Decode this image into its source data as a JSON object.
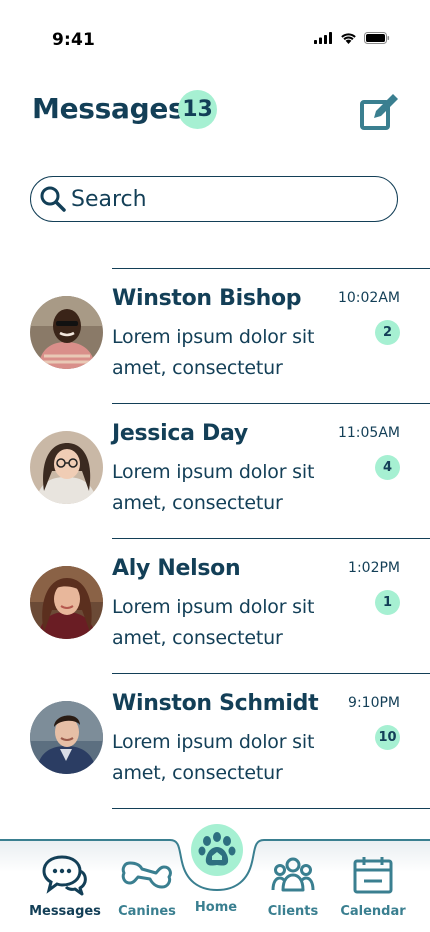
{
  "status": {
    "time": "9:41"
  },
  "header": {
    "title": "Messages",
    "unread_count": "13"
  },
  "search": {
    "placeholder": "Search"
  },
  "conversations": [
    {
      "name": "Winston Bishop",
      "time": "10:02AM",
      "preview": "Lorem ipsum dolor sit amet, consectetur",
      "count": "2"
    },
    {
      "name": "Jessica Day",
      "time": "11:05AM",
      "preview": "Lorem ipsum dolor sit amet, consectetur",
      "count": "4"
    },
    {
      "name": "Aly Nelson",
      "time": "1:02PM",
      "preview": "Lorem ipsum dolor sit amet, consectetur",
      "count": "1"
    },
    {
      "name": "Winston Schmidt",
      "time": "9:10PM",
      "preview": "Lorem ipsum dolor sit amet, consectetur",
      "count": "10"
    }
  ],
  "tabs": {
    "messages": "Messages",
    "canines": "Canines",
    "home": "Home",
    "clients": "Clients",
    "calendar": "Calendar"
  },
  "colors": {
    "primary": "#133f57",
    "accent": "#a6f0d2",
    "secondary": "#3a7f90"
  }
}
